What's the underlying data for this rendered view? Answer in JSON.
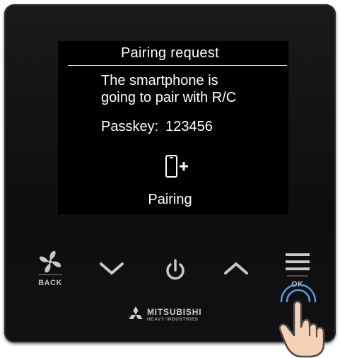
{
  "dialog": {
    "title": "Pairing request",
    "message_line1": "The smartphone is",
    "message_line2": "going to pair with R/C",
    "passkey_label": "Passkey:",
    "passkey_value": "123456",
    "status": "Pairing",
    "status_icon": "phone-plus-icon"
  },
  "buttons": {
    "back_label": "BACK",
    "back_icon": "fan-icon",
    "down_icon": "chevron-down-icon",
    "power_icon": "power-icon",
    "up_icon": "chevron-up-icon",
    "ok_label": "OK",
    "ok_icon": "menu-icon"
  },
  "brand": {
    "name": "MITSUBISHI",
    "subtitle": "HEAVY INDUSTRIES",
    "logo": "three-diamonds-logo"
  },
  "colors": {
    "bezel": "#111113",
    "screen": "#000000",
    "text": "#ffffff",
    "keys": "#c8c8c8",
    "hand_fill": "#f6d2b4",
    "hand_outline": "#4a4a4a",
    "press_ring": "#5b9bd5"
  }
}
